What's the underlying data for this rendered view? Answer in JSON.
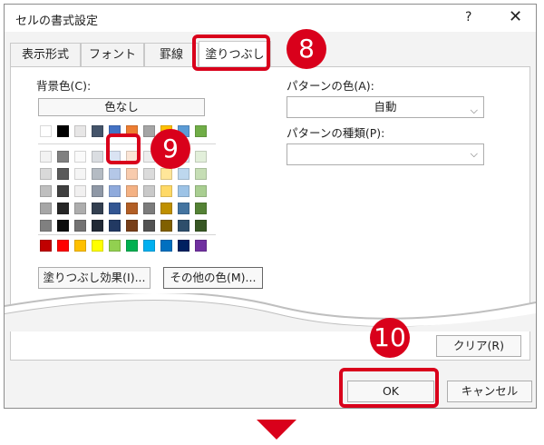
{
  "window": {
    "title": "セルの書式設定",
    "help": "?",
    "close": "✕"
  },
  "tabs": [
    {
      "label": "表示形式"
    },
    {
      "label": "フォント"
    },
    {
      "label": "罫線"
    },
    {
      "label": "塗りつぶし"
    }
  ],
  "fill": {
    "background_label": "背景色(C):",
    "no_color_button": "色なし",
    "effects_button": "塗りつぶし効果(I)...",
    "more_colors_button": "その他の色(M)..."
  },
  "pattern": {
    "color_label": "パターンの色(A):",
    "color_value": "自動",
    "style_label": "パターンの種類(P):",
    "style_value": ""
  },
  "footer": {
    "clear_button": "クリア(R)",
    "ok_button": "OK",
    "cancel_button": "キャンセル"
  },
  "callouts": [
    "8",
    "9",
    "10"
  ],
  "colors": {
    "accent_red": "#d9001b",
    "theme_row1": [
      "#ffffff",
      "#000000",
      "#e7e6e6",
      "#44546a",
      "#4472c4",
      "#ed7d31",
      "#a5a5a5",
      "#ffc000",
      "#5b9bd5",
      "#70ad47"
    ],
    "standard": [
      "#c00000",
      "#ff0000",
      "#ffc000",
      "#ffff00",
      "#92d050",
      "#00b050",
      "#00b0f0",
      "#0070c0",
      "#002060",
      "#7030a0"
    ]
  }
}
